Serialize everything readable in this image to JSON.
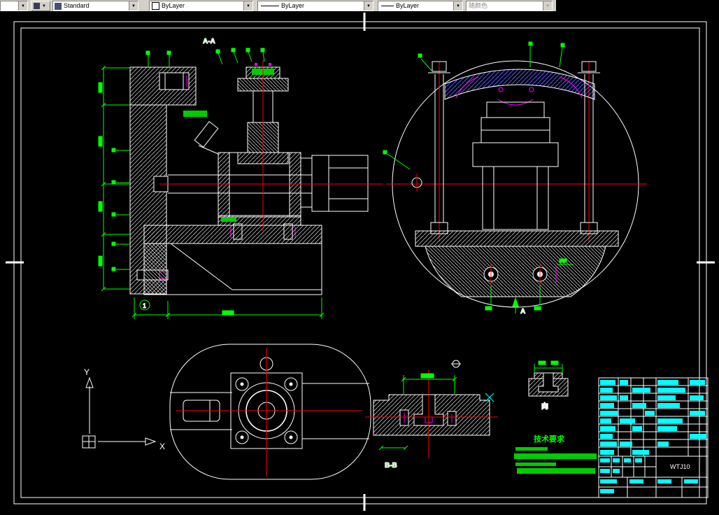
{
  "toolbar": {
    "layer_combo": {
      "value": ""
    },
    "style_combo": {
      "value": "Standard"
    },
    "color_combo": {
      "value": "ByLayer"
    },
    "linetype_combo": {
      "value": "ByLayer"
    },
    "lineweight_combo": {
      "value": "ByLayer"
    },
    "plotstyle_combo": {
      "value": "随颜色"
    }
  },
  "drawing": {
    "section_label_top": "A-A",
    "section_label_bottom": "B-B",
    "direction_view_label": "向",
    "section_arrow_label": "A",
    "datum_balloon": "1",
    "tech_requirements_title": "技术要求",
    "ucs_axis_y": "Y",
    "ucs_axis_x": "X",
    "title_block_code": "WTJ10"
  },
  "colors": {
    "line": "#ffffff",
    "dimension": "#00ff00",
    "centerline": "#ff0000",
    "highlight_cells": "#00ffff",
    "accent": "#ff00ff",
    "hatch_blue": "#5a5aff",
    "background": "#000000",
    "toolbar_bg": "#d4d0c8"
  }
}
